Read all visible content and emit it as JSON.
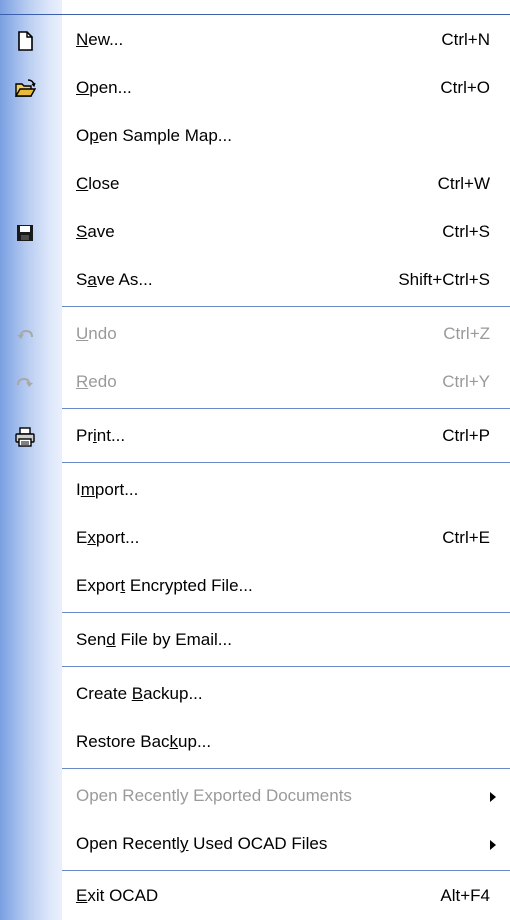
{
  "menu": {
    "items": [
      {
        "pre": "",
        "ul": "N",
        "post": "ew...",
        "shortcut": "Ctrl+N"
      },
      {
        "pre": "",
        "ul": "O",
        "post": "pen...",
        "shortcut": "Ctrl+O"
      },
      {
        "pre": "O",
        "ul": "p",
        "post": "en Sample Map...",
        "shortcut": ""
      },
      {
        "pre": "",
        "ul": "C",
        "post": "lose",
        "shortcut": "Ctrl+W"
      },
      {
        "pre": "",
        "ul": "S",
        "post": "ave",
        "shortcut": "Ctrl+S"
      },
      {
        "pre": "S",
        "ul": "a",
        "post": "ve As...",
        "shortcut": "Shift+Ctrl+S"
      },
      {
        "pre": "",
        "ul": "U",
        "post": "ndo",
        "shortcut": "Ctrl+Z"
      },
      {
        "pre": "",
        "ul": "R",
        "post": "edo",
        "shortcut": "Ctrl+Y"
      },
      {
        "pre": "Pr",
        "ul": "i",
        "post": "nt...",
        "shortcut": "Ctrl+P"
      },
      {
        "pre": "I",
        "ul": "m",
        "post": "port...",
        "shortcut": ""
      },
      {
        "pre": "E",
        "ul": "x",
        "post": "port...",
        "shortcut": "Ctrl+E"
      },
      {
        "pre": "Expor",
        "ul": "t",
        "post": " Encrypted File...",
        "shortcut": ""
      },
      {
        "pre": "Sen",
        "ul": "d",
        "post": " File by Email...",
        "shortcut": ""
      },
      {
        "pre": "Create ",
        "ul": "B",
        "post": "ackup...",
        "shortcut": ""
      },
      {
        "pre": "Restore Bac",
        "ul": "k",
        "post": "up...",
        "shortcut": ""
      },
      {
        "pre": "Open Recently Exported Documents",
        "ul": "",
        "post": "",
        "shortcut": ""
      },
      {
        "pre": "Open Recentl",
        "ul": "y",
        "post": " Used OCAD Files",
        "shortcut": ""
      },
      {
        "pre": "",
        "ul": "E",
        "post": "xit OCAD",
        "shortcut": "Alt+F4"
      }
    ]
  },
  "icons": {
    "new": "new-document-icon",
    "open": "open-folder-icon",
    "save": "floppy-disk-icon",
    "undo": "undo-arrow-icon",
    "redo": "redo-arrow-icon",
    "print": "printer-icon",
    "submenu": "submenu-arrow-icon"
  },
  "colors": {
    "gutter": "#9db7ea",
    "separator": "#6c8ac8",
    "disabled_text": "#9a9a9a"
  }
}
